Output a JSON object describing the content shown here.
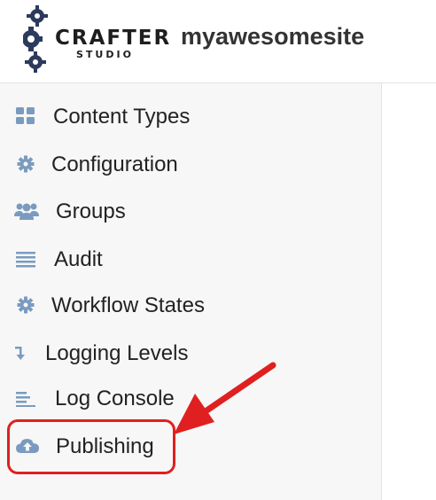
{
  "header": {
    "logo_word": "CRAFTER",
    "logo_sub": "STUDIO",
    "site_name": "myawesomesite"
  },
  "sidebar": {
    "items": [
      {
        "label": "Content Types",
        "icon": "grid-icon"
      },
      {
        "label": "Configuration",
        "icon": "gear-icon"
      },
      {
        "label": "Groups",
        "icon": "users-icon"
      },
      {
        "label": "Audit",
        "icon": "list-icon"
      },
      {
        "label": "Workflow States",
        "icon": "gear-icon"
      },
      {
        "label": "Logging Levels",
        "icon": "level-arrow-icon"
      },
      {
        "label": "Log Console",
        "icon": "align-left-icon"
      },
      {
        "label": "Publishing",
        "icon": "cloud-upload-icon"
      }
    ]
  },
  "colors": {
    "icon": "#7a9bbf",
    "annotation": "#e02020"
  }
}
